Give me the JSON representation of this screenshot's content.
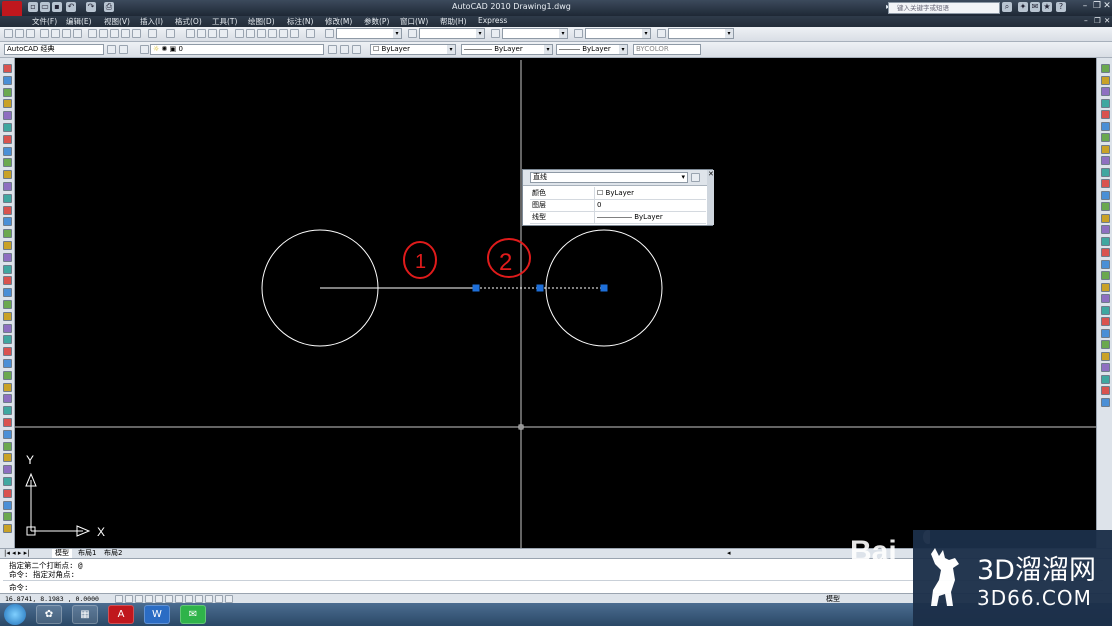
{
  "app": {
    "title": "AutoCAD 2010    Drawing1.dwg",
    "search_placeholder": "键入关键字或短语"
  },
  "menu": [
    "文件(F)",
    "编辑(E)",
    "视图(V)",
    "插入(I)",
    "格式(O)",
    "工具(T)",
    "绘图(D)",
    "标注(N)",
    "修改(M)",
    "参数(P)",
    "窗口(W)",
    "帮助(H)",
    "Express"
  ],
  "toolbar2": {
    "workspace": "AutoCAD 经典",
    "layer": "0",
    "color": "ByLayer",
    "linetype": "ByLayer",
    "lineweight": "ByLayer",
    "plotstyle": "BYCOLOR"
  },
  "quick_properties": {
    "object_type": "直线",
    "rows": [
      {
        "key": "颜色",
        "value": "ByLayer"
      },
      {
        "key": "图层",
        "value": "0"
      },
      {
        "key": "线型",
        "value": "ByLayer"
      }
    ]
  },
  "annotations": {
    "mark1": "1",
    "mark2": "2"
  },
  "ucs": {
    "x_label": "X",
    "y_label": "Y"
  },
  "tabs": [
    "模型",
    "布局1",
    "布局2"
  ],
  "command": {
    "history": [
      "指定第二个打断点: @",
      "命令: 指定对角点:"
    ],
    "prompt": "命令:"
  },
  "status": {
    "coordinates": "16.8741,  8.1983 ,  0.0000",
    "space": "模型"
  },
  "watermark": {
    "brand_cn": "3D溜溜网",
    "brand_url": "3D66.COM",
    "baidu": "Bai"
  },
  "colors": {
    "canvas": "#000000",
    "grip": "#1e6fd9",
    "annotation": "#e01b1b"
  }
}
